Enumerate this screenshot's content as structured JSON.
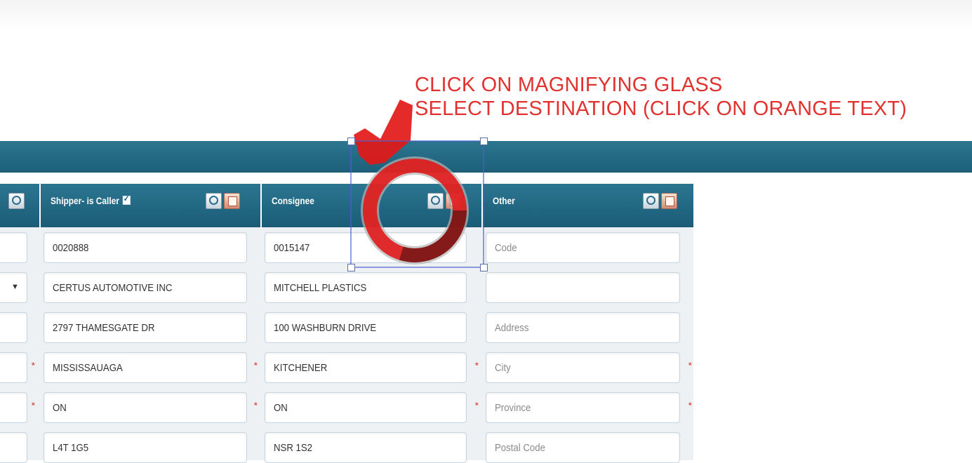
{
  "annotation": {
    "line1": "CLICK ON MAGNIFYING GLASS",
    "line2": "SELECT DESTINATION (CLICK ON ORANGE TEXT)",
    "color": "#e1322f"
  },
  "colors": {
    "header_teal": "#1d5f79",
    "field_border": "#c7d6e0",
    "required_asterisk": "#d9534f"
  },
  "columns": {
    "shipper": {
      "title": "Shipper- is Caller",
      "checkbox_checked": true,
      "icons": [
        "magnifying-glass-icon",
        "notepad-icon"
      ],
      "fields": {
        "code": "0020888",
        "name": "CERTUS AUTOMOTIVE INC",
        "address": "2797 THAMESGATE DR",
        "city": "MISSISSAUAGA",
        "province": "ON",
        "postal_code": "L4T 1G5"
      }
    },
    "consignee": {
      "title": "Consignee",
      "icons": [
        "magnifying-glass-icon",
        "notepad-icon"
      ],
      "fields": {
        "code": "0015147",
        "name": "MITCHELL PLASTICS",
        "address": "100 WASHBURN DRIVE",
        "city": "KITCHENER",
        "province": "ON",
        "postal_code": "NSR 1S2"
      }
    },
    "other": {
      "title": "Other",
      "icons": [
        "magnifying-glass-icon",
        "notepad-icon"
      ],
      "fields": {
        "code": "",
        "name": "",
        "address": "",
        "city": "",
        "province": "",
        "postal_code": ""
      },
      "placeholders": {
        "code": "Code",
        "address": "Address",
        "city": "City",
        "province": "Province",
        "postal_code": "Postal Code"
      }
    }
  },
  "left_column": {
    "icons": [
      "magnifying-glass-icon"
    ],
    "dropdown_arrow": "▼"
  },
  "required_mark": "*"
}
